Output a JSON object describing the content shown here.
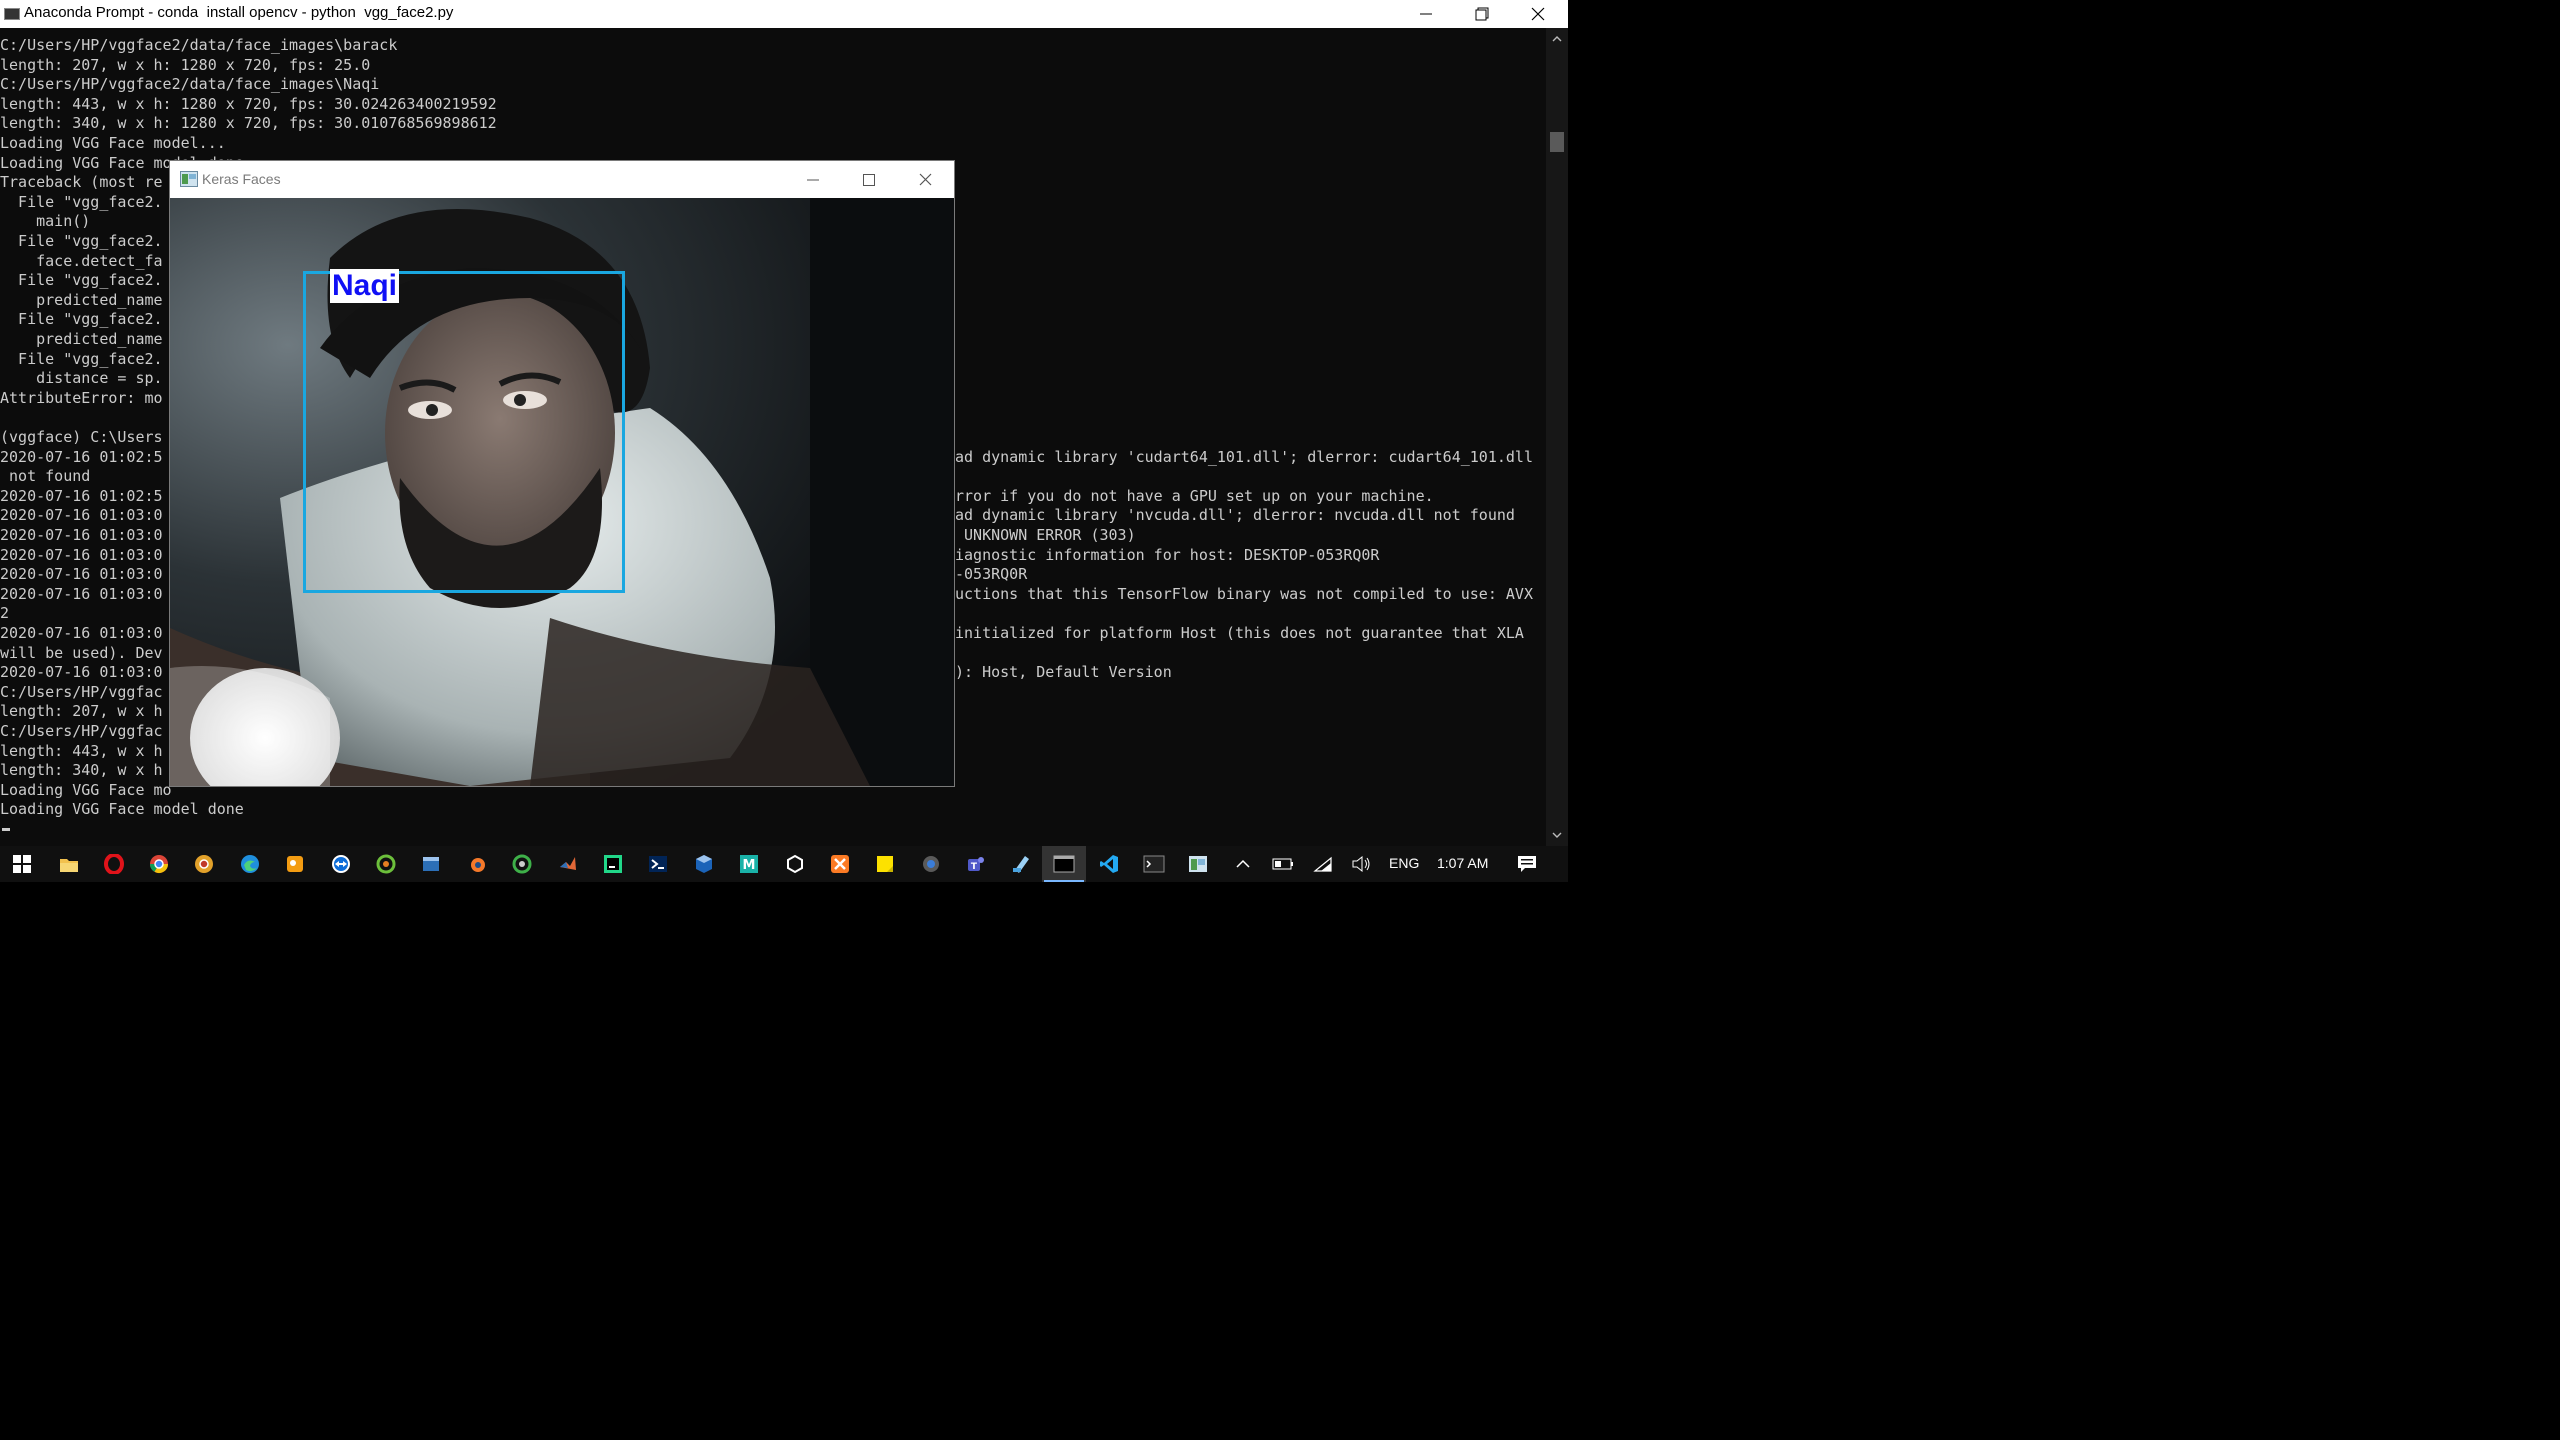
{
  "console_window": {
    "title": "Anaconda Prompt - conda  install opencv - python  vgg_face2.py"
  },
  "console_lines": [
    "C:/Users/HP/vggface2/data/face_images\\barack",
    "length: 207, w x h: 1280 x 720, fps: 25.0",
    "C:/Users/HP/vggface2/data/face_images\\Naqi",
    "length: 443, w x h: 1280 x 720, fps: 30.024263400219592",
    "length: 340, w x h: 1280 x 720, fps: 30.010768569898612",
    "Loading VGG Face model...",
    "Loading VGG Face model done",
    "Traceback (most re",
    "  File \"vgg_face2.",
    "    main()",
    "  File \"vgg_face2.",
    "    face.detect_fa",
    "  File \"vgg_face2.",
    "    predicted_name",
    "  File \"vgg_face2.",
    "    predicted_name",
    "  File \"vgg_face2.",
    "    distance = sp.",
    "AttributeError: mo",
    "",
    "(vggface) C:\\Users",
    "2020-07-16 01:02:5",
    " not found",
    "2020-07-16 01:02:5",
    "2020-07-16 01:03:0",
    "2020-07-16 01:03:0",
    "2020-07-16 01:03:0",
    "2020-07-16 01:03:0",
    "2020-07-16 01:03:0",
    "2",
    "2020-07-16 01:03:0",
    "will be used). Dev",
    "2020-07-16 01:03:0",
    "C:/Users/HP/vggfac",
    "length: 207, w x h",
    "C:/Users/HP/vggfac",
    "length: 443, w x h",
    "length: 340, w x h",
    "Loading VGG Face mo",
    "Loading VGG Face model done"
  ],
  "console_right_lines": [
    {
      "row": 21,
      "text": "ad dynamic library 'cudart64_101.dll'; dlerror: cudart64_101.dll"
    },
    {
      "row": 23,
      "text": "rror if you do not have a GPU set up on your machine."
    },
    {
      "row": 24,
      "text": "ad dynamic library 'nvcuda.dll'; dlerror: nvcuda.dll not found"
    },
    {
      "row": 25,
      "text": " UNKNOWN ERROR (303)"
    },
    {
      "row": 26,
      "text": "iagnostic information for host: DESKTOP-053RQ0R"
    },
    {
      "row": 27,
      "text": "-053RQ0R"
    },
    {
      "row": 28,
      "text": "uctions that this TensorFlow binary was not compiled to use: AVX"
    },
    {
      "row": 30,
      "text": "initialized for platform Host (this does not guarantee that XLA"
    },
    {
      "row": 32,
      "text": "): Host, Default Version"
    }
  ],
  "keras_window": {
    "title": "Keras Faces",
    "face_label": "Naqi",
    "box_color": "#1aa7e0",
    "label_color": "#1010f5"
  },
  "taskbar": {
    "apps": [
      "start",
      "file-explorer",
      "opera",
      "chrome",
      "chrome-canary",
      "edge",
      "paint",
      "teamviewer",
      "snagit",
      "dev-cpp",
      "blender",
      "anaconda-navigator",
      "matlab",
      "pycharm",
      "powershell",
      "virtualbox",
      "mplab",
      "unity",
      "xampp",
      "sticky-notes",
      "camera",
      "teams",
      "notepad",
      "anaconda-prompt",
      "vscode",
      "terminal",
      "keras-faces"
    ],
    "active_app": "anaconda-prompt",
    "language": "ENG",
    "time": "1:07 AM"
  }
}
